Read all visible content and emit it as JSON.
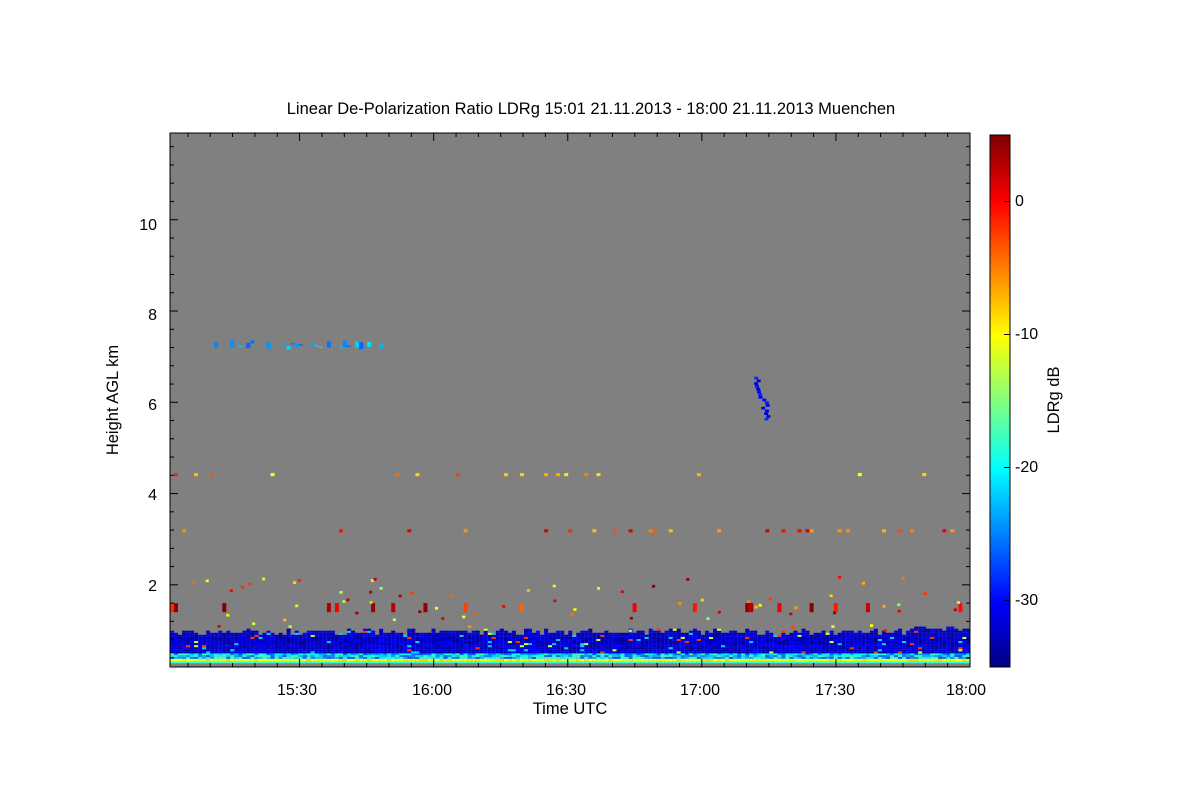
{
  "chart_data": {
    "type": "heatmap",
    "title": "Linear De-Polarization Ratio LDRg   15:01 21.11.2013 - 18:00 21.11.2013 Muenchen",
    "xlabel": "Time UTC",
    "ylabel": "Height AGL km",
    "colorbar_label": "LDRg dB",
    "x_ticks": [
      "15:30",
      "16:00",
      "16:30",
      "17:00",
      "17:30",
      "18:00"
    ],
    "y_ticks": [
      "2",
      "4",
      "6",
      "8",
      "10"
    ],
    "colorbar_ticks": [
      "0",
      "-10",
      "-20",
      "-30"
    ],
    "x_range_minutes_utc": [
      901,
      1080
    ],
    "y_range_km": [
      0.2,
      11.9
    ],
    "colorbar_range_db": [
      -35,
      5
    ],
    "background_color": "#808080",
    "colormap": [
      "#000080",
      "#0000ff",
      "#0080ff",
      "#00ffff",
      "#80ff80",
      "#ffff00",
      "#ff8000",
      "#ff0000",
      "#800000"
    ],
    "layers": [
      {
        "name": "surface",
        "h0": 0.28,
        "h1": 0.38,
        "db": -12
      },
      {
        "name": "near-surface",
        "h0": 0.38,
        "h1": 0.5,
        "db": -22
      },
      {
        "name": "boundary-layer",
        "h0": 0.5,
        "h1": 0.95,
        "db": -32
      },
      {
        "name": "elevated-cloud",
        "h0": 7.15,
        "h1": 7.4,
        "db": -24
      },
      {
        "name": "cirrus-streak",
        "h0": 5.6,
        "h1": 6.5,
        "db": -30
      },
      {
        "name": "noise-4.4km",
        "h0": 4.38,
        "h1": 4.45,
        "db": -6
      },
      {
        "name": "noise-3.2km",
        "h0": 3.15,
        "h1": 3.22,
        "db": -3
      },
      {
        "name": "noise-1.5km",
        "h0": 1.4,
        "h1": 1.6,
        "db": 0
      }
    ]
  }
}
